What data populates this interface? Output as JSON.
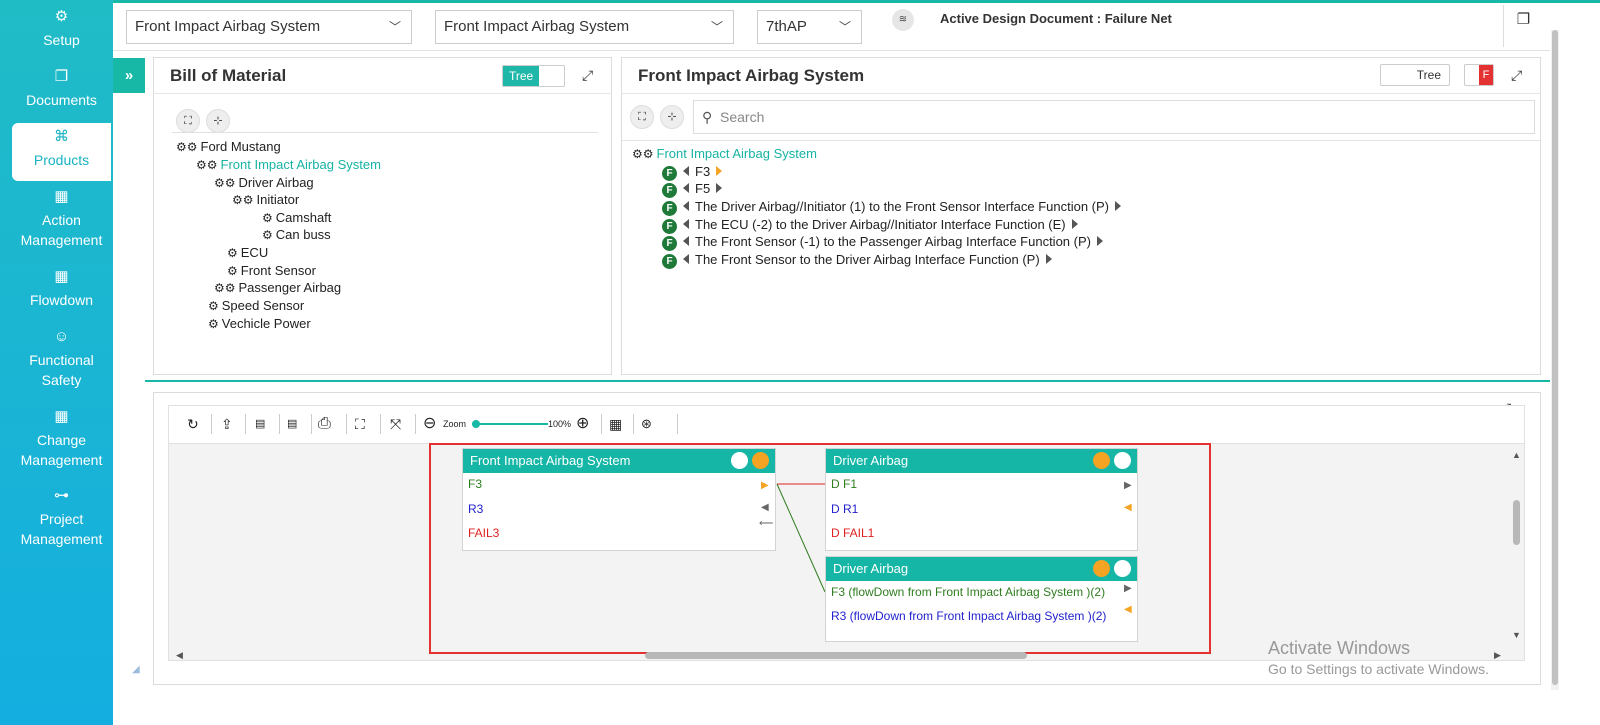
{
  "sidebar": {
    "items": [
      {
        "label": "Setup",
        "icon": "gears-icon"
      },
      {
        "label": "Documents",
        "icon": "documents-icon"
      },
      {
        "label": "Products",
        "icon": "products-icon"
      },
      {
        "label": "Action Management",
        "icon": "building-icon"
      },
      {
        "label": "Flowdown",
        "icon": "building-icon"
      },
      {
        "label": "Functional Safety",
        "icon": "safety-icon"
      },
      {
        "label": "Change Management",
        "icon": "building-icon"
      },
      {
        "label": "Project Management",
        "icon": "network-icon"
      }
    ],
    "active": "Products",
    "collapse_glyph": "»"
  },
  "header": {
    "select1": "Front Impact Airbag System",
    "select2": "Front Impact Airbag System",
    "select3": "7thAP",
    "active_doc": "Active Design Document : Failure Net"
  },
  "bom": {
    "title": "Bill of Material",
    "toggle_label": "Tree",
    "tree": [
      {
        "label": "Ford Mustang"
      },
      {
        "label": "Front Impact Airbag System",
        "selected": true
      },
      {
        "label": "Driver Airbag"
      },
      {
        "label": "Initiator"
      },
      {
        "label": "Camshaft"
      },
      {
        "label": "Can buss"
      },
      {
        "label": "ECU"
      },
      {
        "label": "Front Sensor"
      },
      {
        "label": "Passenger Airbag"
      },
      {
        "label": "Speed Sensor"
      },
      {
        "label": "Vechicle Power"
      }
    ]
  },
  "detail": {
    "title": "Front Impact Airbag System",
    "toggle_label": "Tree",
    "toggle2_label": "F",
    "search_placeholder": "Search",
    "root": "Front Impact Airbag System",
    "functions": [
      {
        "badge": "F",
        "label": "F3"
      },
      {
        "badge": "F",
        "label": "F5"
      },
      {
        "badge": "F",
        "label": "The Driver Airbag//Initiator (1) to the Front Sensor Interface Function (P)"
      },
      {
        "badge": "F",
        "label": "The ECU (-2) to the Driver Airbag//Initiator Interface Function (E)"
      },
      {
        "badge": "F",
        "label": "The Front Sensor (-1) to the Passenger Airbag Interface Function (P)"
      },
      {
        "badge": "F",
        "label": "The Front Sensor to the Driver Airbag Interface Function (P)"
      }
    ]
  },
  "toolbar": {
    "zoom_label": "Zoom",
    "zoom_value": "100%",
    "zoom_fraction": 0.0
  },
  "diagram": {
    "node1": {
      "title": "Front Impact Airbag System",
      "rows": [
        "F3",
        "R3",
        "FAIL3"
      ]
    },
    "node2": {
      "title": "Driver Airbag",
      "rows": [
        "D F1",
        "D R1",
        "D FAIL1"
      ]
    },
    "node3": {
      "title": "Driver Airbag",
      "rows": [
        "F3 (flowDown from Front Impact Airbag System )(2)",
        "R3 (flowDown from Front Impact Airbag System )(2)"
      ]
    }
  },
  "watermark": {
    "line1": "Activate Windows",
    "line2": "Go to Settings to activate Windows."
  },
  "colors": {
    "accent": "#17b8a6",
    "sidebar": "#14aee0",
    "failure": "#e02020",
    "function": "#2e7d1e",
    "requirement": "#2222cc",
    "highlight_box": "#e43232"
  }
}
